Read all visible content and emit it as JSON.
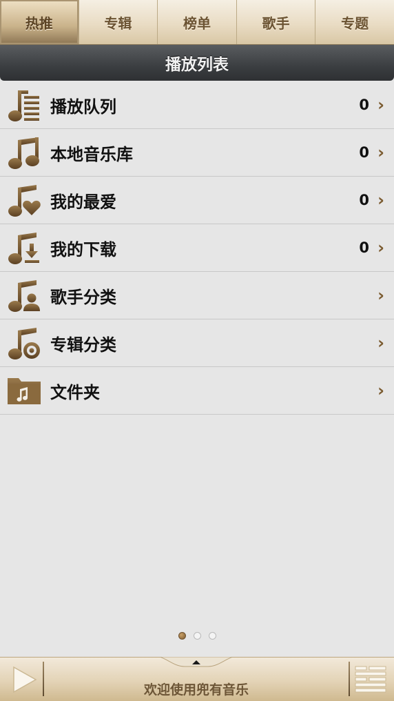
{
  "tabs": [
    {
      "label": "热推",
      "active": true
    },
    {
      "label": "专辑",
      "active": false
    },
    {
      "label": "榜单",
      "active": false
    },
    {
      "label": "歌手",
      "active": false
    },
    {
      "label": "专题",
      "active": false
    }
  ],
  "title": "播放列表",
  "list": [
    {
      "label": "播放队列",
      "count": "0",
      "icon": "playlist-queue-icon"
    },
    {
      "label": "本地音乐库",
      "count": "0",
      "icon": "music-note-icon"
    },
    {
      "label": "我的最爱",
      "count": "0",
      "icon": "favorite-heart-icon"
    },
    {
      "label": "我的下载",
      "count": "0",
      "icon": "download-icon"
    },
    {
      "label": "歌手分类",
      "count": "",
      "icon": "artist-icon"
    },
    {
      "label": "专辑分类",
      "count": "",
      "icon": "album-disc-icon"
    },
    {
      "label": "文件夹",
      "count": "",
      "icon": "folder-icon"
    }
  ],
  "chevron": "›",
  "page_indicator": {
    "total": 3,
    "current": 1
  },
  "player": {
    "now_playing": "欢迎使用兜有音乐"
  },
  "colors": {
    "accent_brown": "#7a5a2f",
    "title_bar": "#3b3e41",
    "background": "#e6e6e6"
  }
}
